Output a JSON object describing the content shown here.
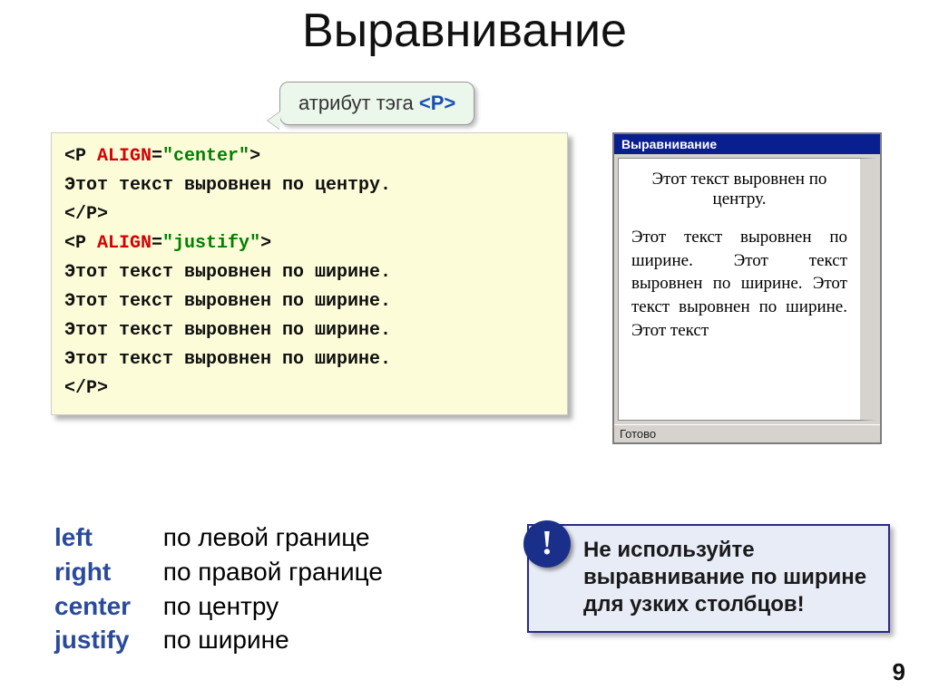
{
  "title": "Выравнивание",
  "callout": {
    "label": "атрибут тэга ",
    "tag": "<P>"
  },
  "code": {
    "l1a": "<P ",
    "l1b": "ALIGN",
    "l1c": "=",
    "l1d": "\"center\"",
    "l1e": ">",
    "l2": "Этот текст выровнен по центру.",
    "l3": "</P>",
    "l4a": "<P ",
    "l4b": "ALIGN",
    "l4c": "=",
    "l4d": "\"justify\"",
    "l4e": ">",
    "l5": "Этот текст выровнен по ширине.",
    "l6": "Этот текст выровнен по ширине.",
    "l7": "Этот текст выровнен по ширине.",
    "l8": "Этот текст выровнен по ширине.",
    "l9": "</P>"
  },
  "browser": {
    "title": "Выравнивание",
    "center_text": "Этот текст выровнен по центру.",
    "justify_text": "Этот текст выровнен по ширине. Этот текст выровнен по ширине. Этот текст выровнен по ширине. Этот текст",
    "status": "Готово"
  },
  "aligns": [
    {
      "kw": "left",
      "desc": "по левой границе"
    },
    {
      "kw": "right",
      "desc": "по правой границе"
    },
    {
      "kw": "center",
      "desc": "по центру"
    },
    {
      "kw": "justify",
      "desc": "по ширине"
    }
  ],
  "warn": {
    "icon": "!",
    "text": "Не используйте выравнивание по ширине для узких столбцов!"
  },
  "page_num": "9"
}
